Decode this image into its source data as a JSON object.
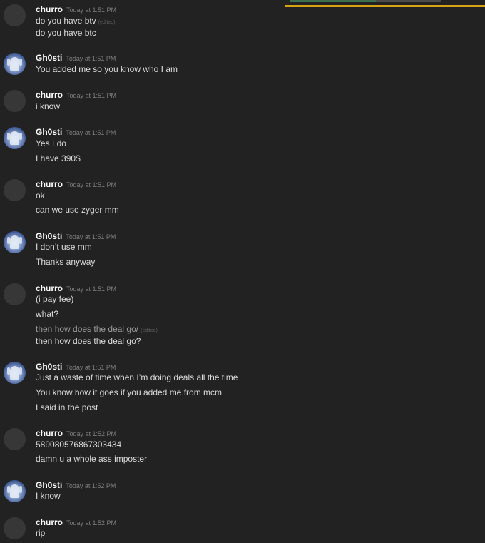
{
  "colors": {
    "background": "#222222",
    "username": "#ffffff",
    "message_text": "#dcdcdc",
    "timestamp": "#7e7e7e",
    "accent_bar": "#d8a313"
  },
  "messages": [
    {
      "user": "churro",
      "avatar": "default-avatar",
      "time": "Today at 1:51 PM",
      "lines": [
        {
          "text": "do you have btv",
          "edited": "(edited)"
        },
        {
          "text": "do you have btc"
        }
      ]
    },
    {
      "user": "Gh0sti",
      "avatar": "ghost-avatar",
      "time": "Today at 1:51 PM",
      "lines": [
        {
          "text": "You added me so you know who I am"
        }
      ]
    },
    {
      "user": "churro",
      "avatar": "default-avatar",
      "time": "Today at 1:51 PM",
      "lines": [
        {
          "text": "i know"
        }
      ]
    },
    {
      "user": "Gh0sti",
      "avatar": "ghost-avatar",
      "time": "Today at 1:51 PM",
      "lines": [
        {
          "text": "Yes I do"
        },
        {
          "text": "I have 390$"
        }
      ]
    },
    {
      "user": "churro",
      "avatar": "default-avatar",
      "time": "Today at 1:51 PM",
      "lines": [
        {
          "text": "ok"
        },
        {
          "text": "can we use zyger mm"
        }
      ]
    },
    {
      "user": "Gh0sti",
      "avatar": "ghost-avatar",
      "time": "Today at 1:51 PM",
      "lines": [
        {
          "text": "I don’t use mm"
        },
        {
          "text": "Thanks anyway"
        }
      ]
    },
    {
      "user": "churro",
      "avatar": "default-avatar",
      "time": "Today at 1:51 PM",
      "lines": [
        {
          "text": "(i pay fee)"
        },
        {
          "text": "what?"
        },
        {
          "text": "then how does the deal go/",
          "edited": "(edited)",
          "dim": true
        },
        {
          "text": "then how does the deal go?"
        }
      ]
    },
    {
      "user": "Gh0sti",
      "avatar": "ghost-avatar",
      "time": "Today at 1:51 PM",
      "lines": [
        {
          "text": "Just a waste of time when I’m doing deals all the time"
        },
        {
          "text": "You know how it goes if you added me from mcm"
        },
        {
          "text": "I said in the post"
        }
      ]
    },
    {
      "user": "churro",
      "avatar": "default-avatar",
      "time": "Today at 1:52 PM",
      "lines": [
        {
          "text": "589080576867303434"
        },
        {
          "text": "damn u a whole ass imposter"
        }
      ]
    },
    {
      "user": "Gh0sti",
      "avatar": "ghost-avatar",
      "time": "Today at 1:52 PM",
      "lines": [
        {
          "text": "I know"
        }
      ]
    },
    {
      "user": "churro",
      "avatar": "default-avatar",
      "time": "Today at 1:52 PM",
      "lines": [
        {
          "text": "rip"
        }
      ]
    }
  ]
}
